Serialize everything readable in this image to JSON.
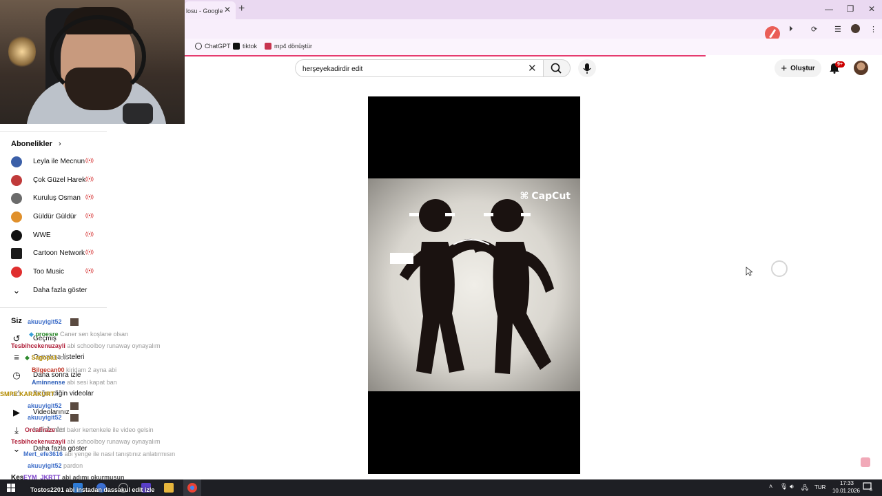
{
  "browser": {
    "tab_title": "losu - Google",
    "bookmarks": [
      {
        "label": "ChatGPT",
        "icon": "chatgpt-icon"
      },
      {
        "label": "tiktok",
        "icon": "tiktok-icon"
      },
      {
        "label": "mp4 dönüştür",
        "icon": "converter-icon"
      }
    ],
    "page_load_progress": 0.75
  },
  "header": {
    "search_value": "herşeyekadirdir edit",
    "create_label": "Oluştur",
    "notification_badge": "9+"
  },
  "sidebar": {
    "subscriptions_title": "Abonelikler",
    "channels": [
      {
        "label": "Leyla ile Mecnun",
        "color": "#3b5fa8"
      },
      {
        "label": "Çok Güzel Harek…",
        "color": "#c03a3a"
      },
      {
        "label": "Kuruluş Osman",
        "color": "#6b6b6b"
      },
      {
        "label": "Güldür Güldür",
        "color": "#e0902c"
      },
      {
        "label": "WWE",
        "color": "#111111"
      },
      {
        "label": "Cartoon Network…",
        "color": "#1b1b1b"
      },
      {
        "label": "Too Music",
        "color": "#e02f2f"
      }
    ],
    "show_more_label": "Daha fazla göster",
    "you_title": "Siz",
    "you_items": [
      {
        "label": "Geçmiş",
        "icon": "history-icon"
      },
      {
        "label": "Oynatma listeleri",
        "icon": "playlist-icon"
      },
      {
        "label": "Daha sonra izle",
        "icon": "watch-later-icon"
      },
      {
        "label": "Beğendiğin videolar",
        "icon": "like-icon"
      },
      {
        "label": "Videolarınız",
        "icon": "your-videos-icon"
      },
      {
        "label": "İndirilenler",
        "icon": "download-icon"
      }
    ],
    "you_show_more_label": "Daha fazla göster",
    "cut_off_label": "Keş"
  },
  "chat": [
    {
      "user": "akuuyigit52",
      "msg": "",
      "color": "#3f6fc9"
    },
    {
      "user": "proesre",
      "msg": "Caner sen koşlane olsan",
      "color": "#2d8a2d"
    },
    {
      "user": "Tesbihcekenuzayli",
      "msg": "abi schoolboy runaway oynayalım",
      "color": "#b0233c"
    },
    {
      "user": "Sagopa1",
      "msg": "lolc",
      "color": "#b38b00"
    },
    {
      "user": "Bilgecan00",
      "msg": "kiridam 2 ayna abi",
      "color": "#c0392b"
    },
    {
      "user": "Aminnense",
      "msg": "abi sesi kapat ban",
      "color": "#2e5fb8"
    },
    {
      "user": "SMPE KARAKURT",
      "msg": "",
      "color": "#b38b00"
    },
    {
      "user": "akuuyigit52",
      "msg": "",
      "color": "#3f6fc9"
    },
    {
      "user": "akuuyigit52",
      "msg": "",
      "color": "#3f6fc9"
    },
    {
      "user": "OrcaFraze",
      "msg": "abi bakır kertenkele ile video gelsin",
      "color": "#b0233c"
    },
    {
      "user": "Tesbihcekenuzayli",
      "msg": "abi schoolboy runaway oynayalım",
      "color": "#b0233c"
    },
    {
      "user": "Mert_efe3616",
      "msg": "abi yenge ile nasıl tanıştınız anlatırmısın",
      "color": "#3f6fc9"
    },
    {
      "user": "akuuyigit52",
      "msg": "pardon",
      "color": "#3f6fc9"
    },
    {
      "user": "EYM_JKRTT",
      "msg": "abi adımı okurmusun",
      "color": "#7a3fc9"
    },
    {
      "user": "Tostos2201",
      "msg": "abi instadan dassakul edit izle",
      "color": "#ffffff"
    }
  ],
  "video": {
    "watermark": "CapCut"
  },
  "taskbar": {
    "language": "TUR",
    "time": "17:33",
    "date": "10.01.2026",
    "notif_count": "6"
  }
}
